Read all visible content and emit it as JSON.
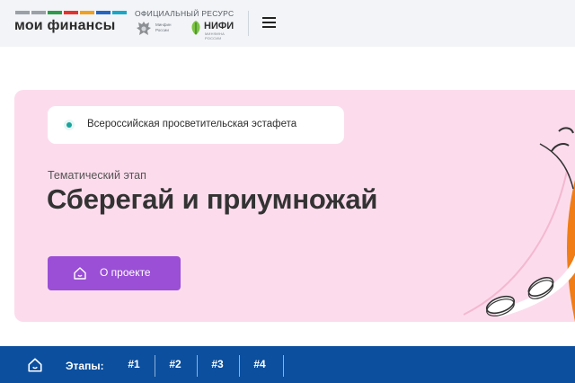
{
  "header": {
    "logo_text": "мои финансы",
    "logo_colors": [
      "#9aa0a6",
      "#2f9a4b",
      "#e2342f",
      "#f0a020",
      "#2466c2",
      "#6a3fb8",
      "#19a7c7"
    ],
    "official_label": "ОФИЦИАЛЬНЫЙ РЕСУРС",
    "partners": {
      "minfin": {
        "line1": "Минфин",
        "line2": "России"
      },
      "nifi": {
        "title": "НИФИ",
        "subtitle": "МИНФИНА РОССИИ"
      }
    },
    "menu_icon": "hamburger-menu-icon"
  },
  "hero": {
    "badge_text": "Всероссийская просветительская эстафета",
    "stage_label": "Тематический этап",
    "title": "Сберегай и приумножай",
    "button_label": "О проекте",
    "button_icon": "house-icon",
    "colors": {
      "background": "#fcdcec",
      "button": "#9a4fd6",
      "accent": "#1ba39c",
      "coin": "#f07d16"
    }
  },
  "nav": {
    "home_icon": "house-icon",
    "label": "Этапы:",
    "items": [
      "#1",
      "#2",
      "#3",
      "#4"
    ],
    "background": "#0b4f9e"
  }
}
